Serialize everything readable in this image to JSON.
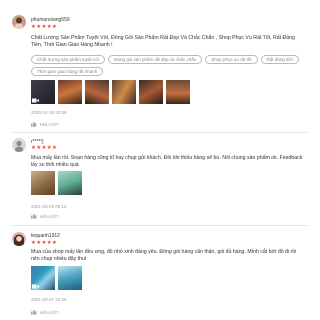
{
  "reviews": [
    {
      "username": "phumunoiang559",
      "stars": "★★★★★",
      "text": "Chất Lượng Sản Phẩm Tuyệt Vời, Đóng Gói Sản Phẩm Rất Đẹp Và Chắc Chắn , Shop Phục Vụ Rất Tốt, Rất Đáng Tiền, Thời Gian Giao Hàng Nhanh !",
      "tags": [
        "Chất lượng sản phẩm tuyệt vời",
        "Đóng gói sản phẩm rất đẹp và chắc chắn",
        "Shop phục vụ rất tốt",
        "Rất đáng tiền",
        "Thời gian giao hàng rất nhanh"
      ],
      "date": "2020-12-19 20:08",
      "like_label": "Hữu ích?"
    },
    {
      "username": "r*****j",
      "stars": "★★★★★",
      "text": "Mua mấy lần rồi. Soạn hàng cũng kĩ hay chụp gửi khách. Đồi khi thiếu hàng sẽ bù. Nói chung sản phẩm ok. Feedback lấy xu thôi nhiều quá",
      "date": "2021-03-29 09:15",
      "like_label": "Hữu ích?"
    },
    {
      "username": "lequanh1912",
      "stars": "★★★★★",
      "text": "Mua của shop mấy lần đều ưng, đồ nhỏ xinh đáng yêu. Đóng gói hàng cẩn thận, gói đủ hàng. Mình cắt bớt đồ đi rồi nên chụp nhiều đây thui",
      "date": "2021-03-07 22:26",
      "like_label": "Hữu ích?"
    }
  ],
  "colors": {
    "star": "#ee4d2d",
    "meta": "#999999"
  }
}
